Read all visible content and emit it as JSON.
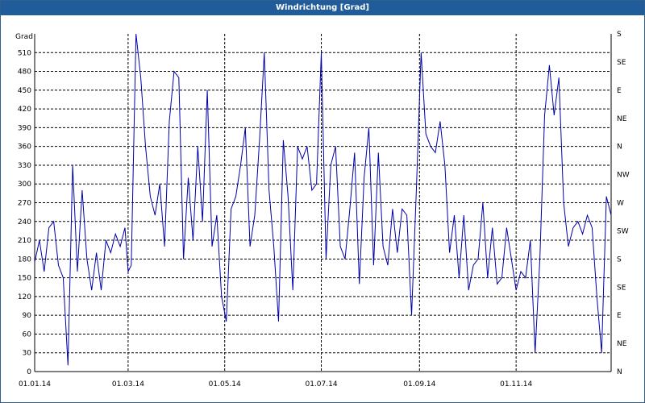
{
  "window": {
    "title": "Windrichtung [Grad]"
  },
  "chart_data": {
    "type": "line",
    "title": "Windrichtung [Grad]",
    "ylabel": "Grad",
    "ylim": [
      0,
      540
    ],
    "xlim": [
      "2014-01-01",
      "2014-12-31"
    ],
    "grid": true,
    "grid_style": "dashed",
    "line_color": "#0000aa",
    "y_ticks": [
      0,
      30,
      60,
      90,
      120,
      150,
      180,
      210,
      240,
      270,
      300,
      330,
      360,
      390,
      420,
      450,
      480,
      510
    ],
    "x_ticks": [
      {
        "date": "2014-01-01",
        "label": "01.01.14"
      },
      {
        "date": "2014-03-01",
        "label": "01.03.14"
      },
      {
        "date": "2014-05-01",
        "label": "01.05.14"
      },
      {
        "date": "2014-07-01",
        "label": "01.07.14"
      },
      {
        "date": "2014-09-01",
        "label": "01.09.14"
      },
      {
        "date": "2014-11-01",
        "label": "01.11.14"
      }
    ],
    "right_axis": {
      "labels": [
        "N",
        "NE",
        "E",
        "SE",
        "S",
        "SW",
        "W",
        "NW",
        "N",
        "NE",
        "E",
        "SE",
        "S"
      ],
      "values": [
        0,
        45,
        90,
        135,
        180,
        225,
        270,
        315,
        360,
        405,
        450,
        495,
        540
      ]
    },
    "series": [
      {
        "x": [
          "2014-01-01",
          "2014-01-04",
          "2014-01-07",
          "2014-01-10",
          "2014-01-13",
          "2014-01-16",
          "2014-01-19",
          "2014-01-22",
          "2014-01-25",
          "2014-01-28",
          "2014-01-31",
          "2014-02-03",
          "2014-02-06",
          "2014-02-09",
          "2014-02-12",
          "2014-02-15",
          "2014-02-18",
          "2014-02-21",
          "2014-02-24",
          "2014-02-27",
          "2014-03-01",
          "2014-03-03",
          "2014-03-06",
          "2014-03-09",
          "2014-03-12",
          "2014-03-15",
          "2014-03-18",
          "2014-03-21",
          "2014-03-24",
          "2014-03-27",
          "2014-03-30",
          "2014-04-02",
          "2014-04-05",
          "2014-04-08",
          "2014-04-11",
          "2014-04-14",
          "2014-04-17",
          "2014-04-20",
          "2014-04-23",
          "2014-04-26",
          "2014-04-29",
          "2014-05-02",
          "2014-05-05",
          "2014-05-08",
          "2014-05-11",
          "2014-05-14",
          "2014-05-17",
          "2014-05-20",
          "2014-05-23",
          "2014-05-26",
          "2014-05-29",
          "2014-06-01",
          "2014-06-04",
          "2014-06-07",
          "2014-06-10",
          "2014-06-13",
          "2014-06-16",
          "2014-06-19",
          "2014-06-22",
          "2014-06-25",
          "2014-06-28",
          "2014-07-01",
          "2014-07-04",
          "2014-07-07",
          "2014-07-10",
          "2014-07-13",
          "2014-07-16",
          "2014-07-19",
          "2014-07-22",
          "2014-07-25",
          "2014-07-28",
          "2014-07-31",
          "2014-08-03",
          "2014-08-06",
          "2014-08-09",
          "2014-08-12",
          "2014-08-15",
          "2014-08-18",
          "2014-08-21",
          "2014-08-24",
          "2014-08-27",
          "2014-08-30",
          "2014-09-02",
          "2014-09-05",
          "2014-09-08",
          "2014-09-11",
          "2014-09-14",
          "2014-09-17",
          "2014-09-20",
          "2014-09-23",
          "2014-09-26",
          "2014-09-29",
          "2014-10-02",
          "2014-10-05",
          "2014-10-08",
          "2014-10-11",
          "2014-10-14",
          "2014-10-17",
          "2014-10-20",
          "2014-10-23",
          "2014-10-26",
          "2014-10-29",
          "2014-11-01",
          "2014-11-04",
          "2014-11-07",
          "2014-11-10",
          "2014-11-13",
          "2014-11-16",
          "2014-11-19",
          "2014-11-22",
          "2014-11-25",
          "2014-11-28",
          "2014-12-01",
          "2014-12-04",
          "2014-12-07",
          "2014-12-10",
          "2014-12-13",
          "2014-12-16",
          "2014-12-19",
          "2014-12-22",
          "2014-12-25",
          "2014-12-28",
          "2014-12-31"
        ],
        "y": [
          175,
          210,
          160,
          230,
          240,
          170,
          150,
          10,
          330,
          160,
          290,
          180,
          130,
          190,
          130,
          210,
          190,
          220,
          200,
          230,
          160,
          170,
          540,
          470,
          360,
          280,
          250,
          300,
          200,
          400,
          480,
          470,
          180,
          310,
          210,
          360,
          240,
          450,
          200,
          250,
          120,
          80,
          260,
          280,
          330,
          390,
          200,
          250,
          370,
          510,
          290,
          200,
          80,
          370,
          280,
          130,
          360,
          340,
          360,
          290,
          300,
          510,
          180,
          330,
          360,
          200,
          180,
          260,
          350,
          140,
          310,
          390,
          170,
          350,
          200,
          170,
          260,
          190,
          260,
          250,
          90,
          290,
          510,
          380,
          360,
          350,
          400,
          330,
          190,
          250,
          150,
          250,
          130,
          170,
          180,
          270,
          150,
          230,
          140,
          150,
          230,
          180,
          130,
          160,
          150,
          210,
          30,
          180,
          410,
          490,
          410,
          470,
          270,
          200,
          230,
          240,
          220,
          250,
          230,
          120,
          30,
          280,
          250
        ]
      }
    ]
  }
}
